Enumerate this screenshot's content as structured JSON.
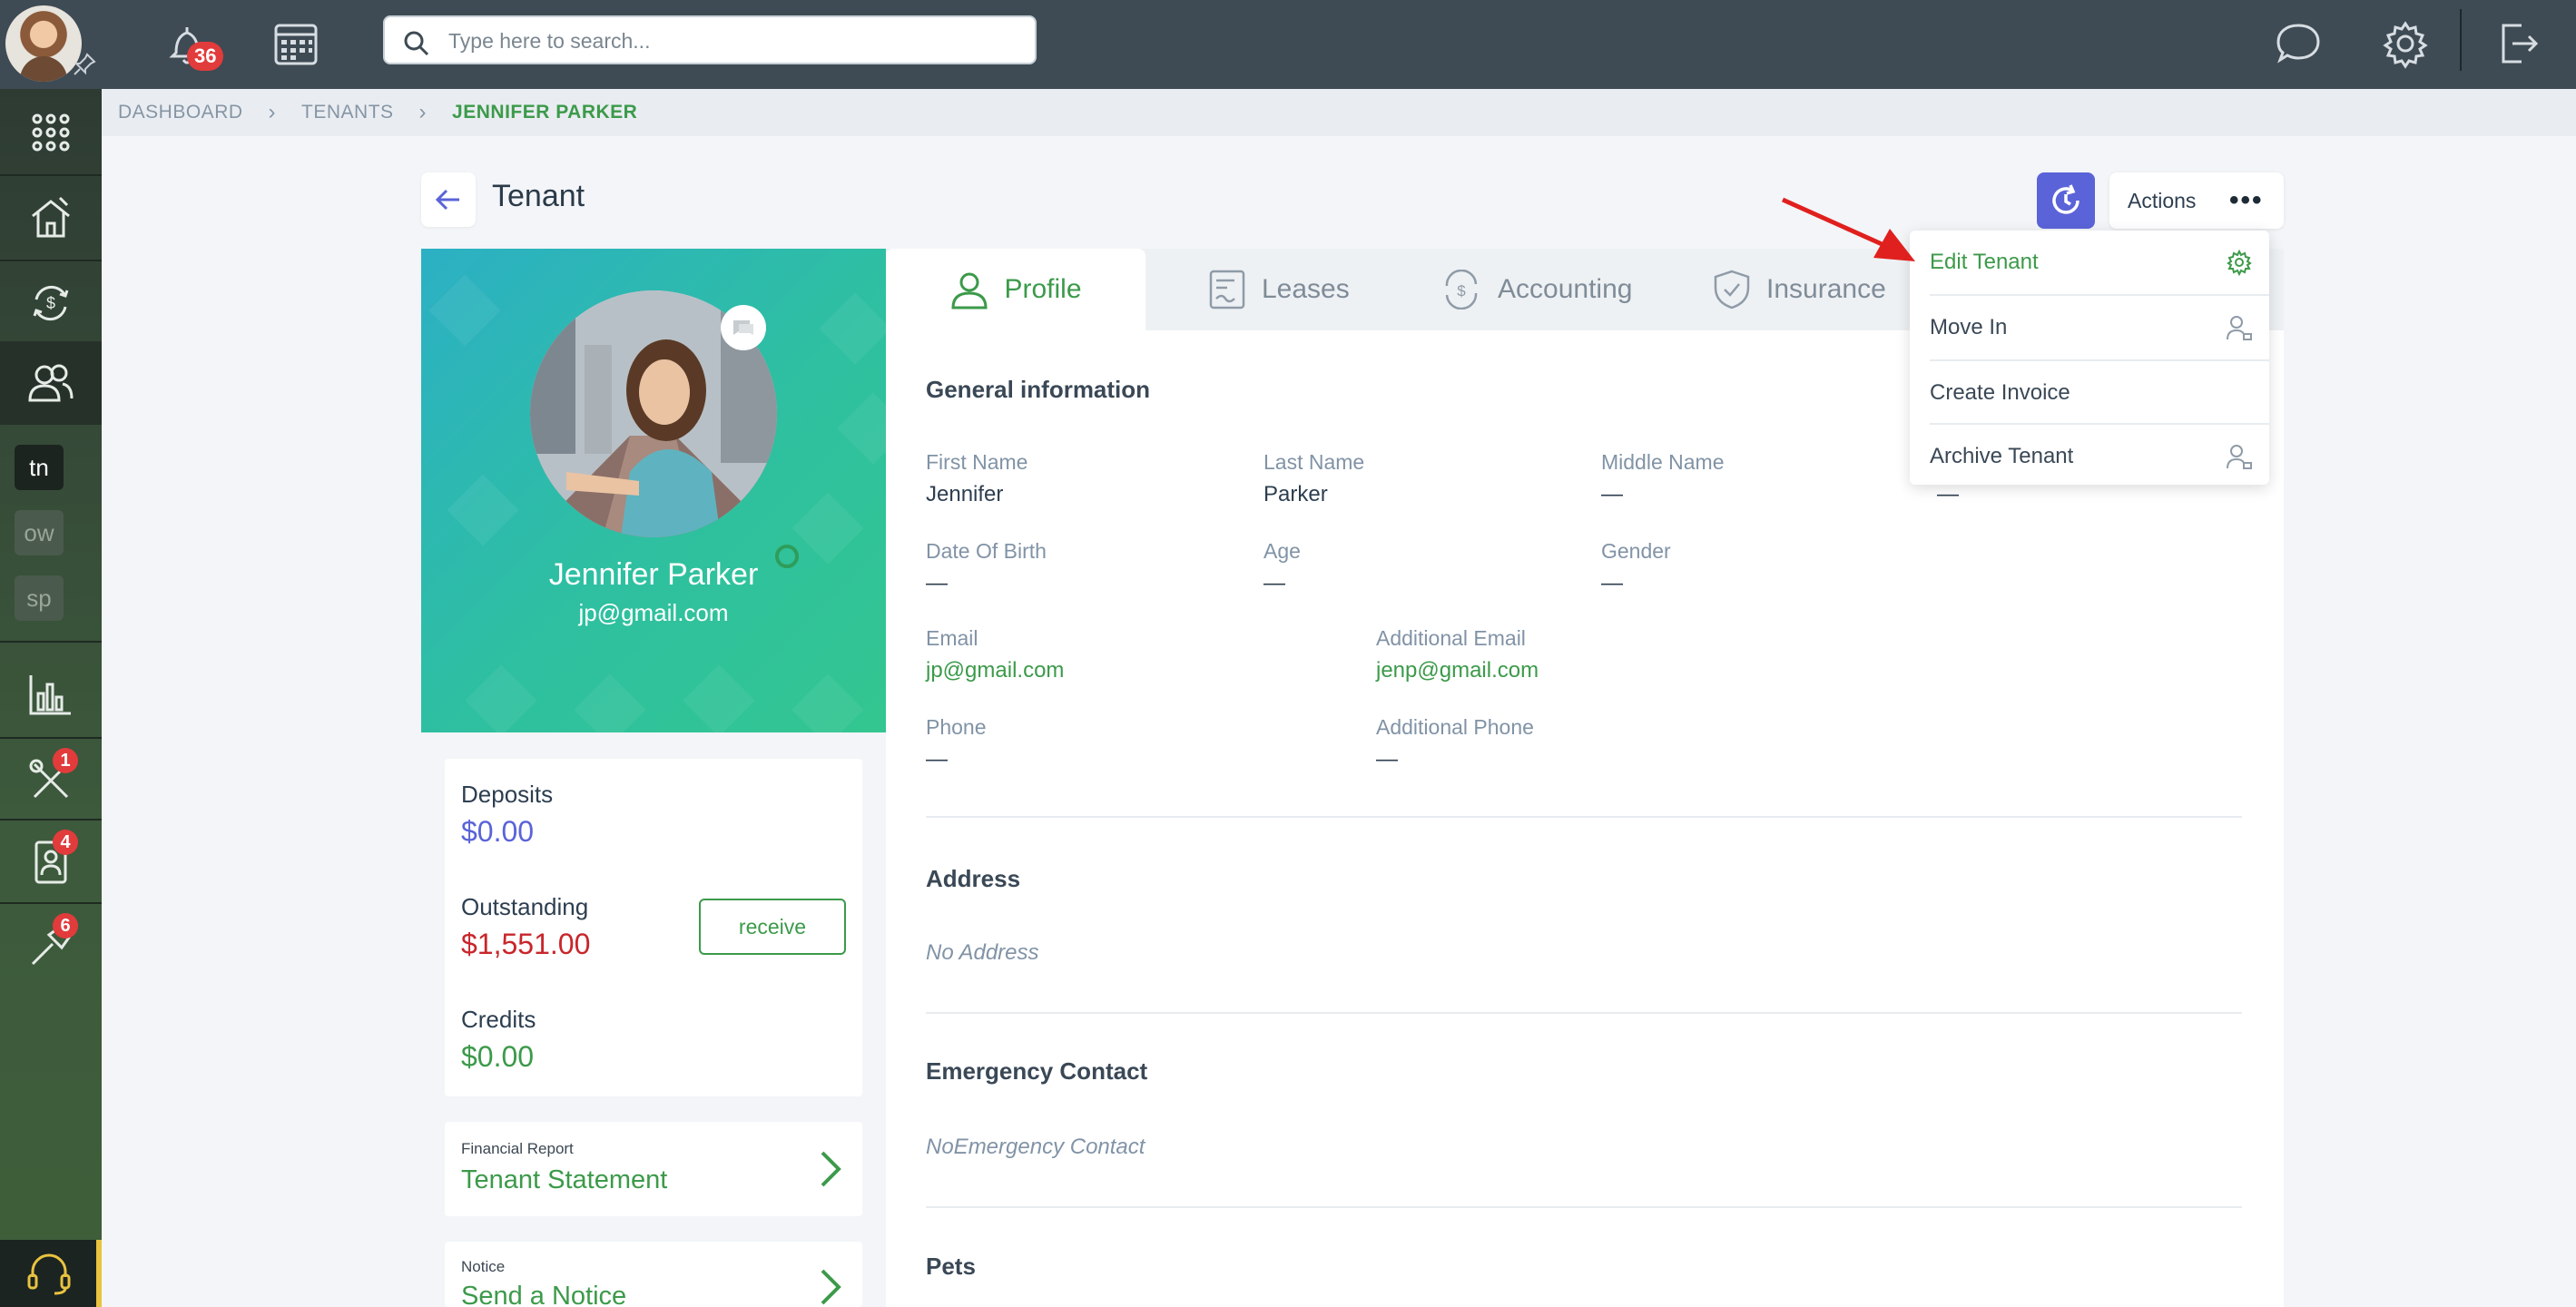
{
  "topbar": {
    "notifications_count": "36",
    "search_placeholder": "Type here to search..."
  },
  "sidebar": {
    "abbr_tn": "tn",
    "abbr_ow": "ow",
    "abbr_sp": "sp",
    "maintenance_badge": "1",
    "requests_badge": "4",
    "tools_badge": "6"
  },
  "breadcrumb": {
    "dashboard": "DASHBOARD",
    "tenants": "TENANTS",
    "current": "JENNIFER PARKER"
  },
  "header": {
    "title": "Tenant",
    "actions_label": "Actions",
    "more_label": "•••"
  },
  "profile": {
    "name": "Jennifer Parker",
    "email": "jp@gmail.com"
  },
  "balances": {
    "deposits_label": "Deposits",
    "deposits_value": "$0.00",
    "outstanding_label": "Outstanding",
    "outstanding_value": "$1,551.00",
    "receive_label": "receive",
    "credits_label": "Credits",
    "credits_value": "$0.00"
  },
  "links": {
    "financial_small": "Financial Report",
    "financial_big": "Tenant Statement",
    "notice_small": "Notice",
    "notice_big": "Send a Notice"
  },
  "tabs": {
    "profile": "Profile",
    "leases": "Leases",
    "accounting": "Accounting",
    "insurance": "Insurance"
  },
  "general": {
    "title": "General information",
    "first_name_label": "First Name",
    "first_name": "Jennifer",
    "last_name_label": "Last Name",
    "last_name": "Parker",
    "middle_name_label": "Middle Name",
    "middle_name": "—",
    "hidden_value": "—",
    "dob_label": "Date Of Birth",
    "dob": "—",
    "age_label": "Age",
    "age": "—",
    "gender_label": "Gender",
    "gender": "—",
    "email_label": "Email",
    "email": "jp@gmail.com",
    "add_email_label": "Additional Email",
    "add_email": "jenp@gmail.com",
    "phone_label": "Phone",
    "phone": "—",
    "add_phone_label": "Additional Phone",
    "add_phone": "—"
  },
  "address": {
    "title": "Address",
    "empty": "No Address"
  },
  "emergency": {
    "title": "Emergency Contact",
    "empty": "NoEmergency Contact"
  },
  "pets": {
    "title": "Pets"
  },
  "dropdown": {
    "edit": "Edit Tenant",
    "move_in": "Move In",
    "invoice": "Create Invoice",
    "archive": "Archive Tenant"
  },
  "colors": {
    "accent_green": "#3c9a4a",
    "brand_blue": "#5a63d8",
    "danger_red": "#c8262b",
    "topbar": "#3e4b54"
  }
}
